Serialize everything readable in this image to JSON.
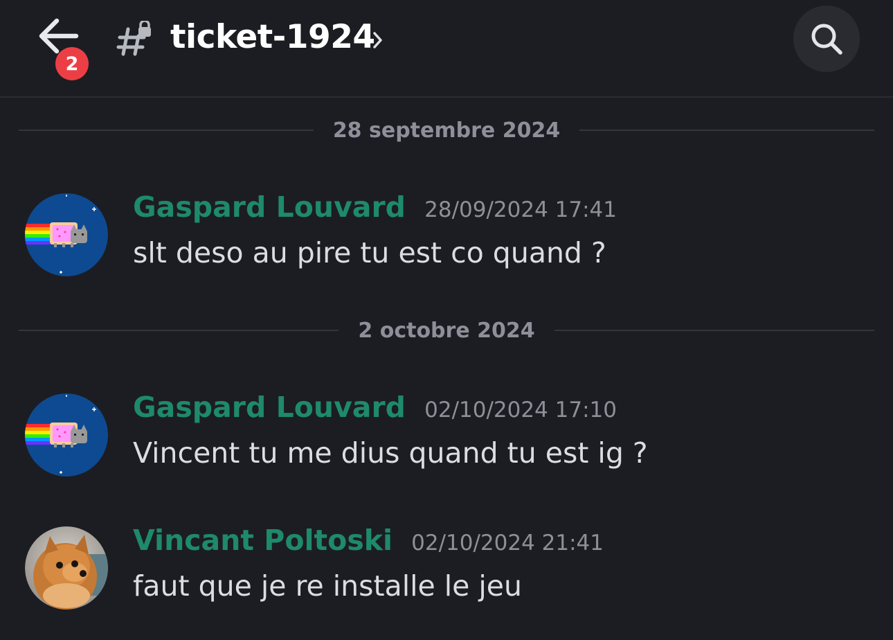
{
  "header": {
    "back_badge_count": "2",
    "channel_name": "ticket-1924"
  },
  "dividers": [
    {
      "date": "28 septembre 2024"
    },
    {
      "date": "2 octobre 2024"
    }
  ],
  "messages": [
    {
      "author": "Gaspard Louvard",
      "timestamp": "28/09/2024 17:41",
      "text": "slt deso au pire tu est co quand ?",
      "avatar": "nyan-cat-avatar"
    },
    {
      "author": "Gaspard Louvard",
      "timestamp": "02/10/2024 17:10",
      "text": "Vincent tu me dius quand tu est ig ?",
      "avatar": "nyan-cat-avatar"
    },
    {
      "author": "Vincant Poltoski",
      "timestamp": "02/10/2024 21:41",
      "text": "faut que je re installe le jeu",
      "avatar": "pomeranian-dog-avatar"
    }
  ],
  "colors": {
    "background": "#1c1d22",
    "author": "#1e8a6a",
    "badge": "#ec3f45",
    "muted": "#8d9099"
  }
}
